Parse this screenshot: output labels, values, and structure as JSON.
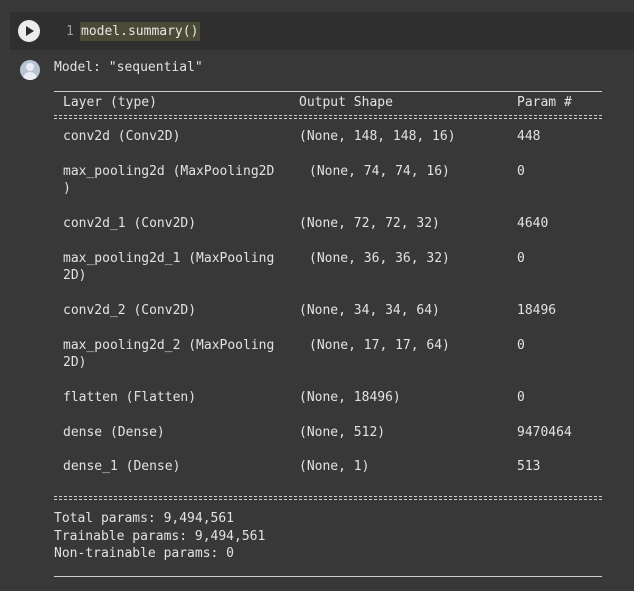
{
  "cell": {
    "line_number": "1",
    "code": "model.summary()"
  },
  "output": {
    "model_title": "Model: \"sequential\"",
    "headers": {
      "layer": "Layer (type)",
      "shape": "Output Shape",
      "params": "Param #"
    },
    "rows": [
      {
        "layer": "conv2d (Conv2D)",
        "layer_cont": "",
        "shape": "(None, 148, 148, 16)",
        "params": "448"
      },
      {
        "layer": "max_pooling2d (MaxPooling2D",
        "layer_cont": ")",
        "shape": "(None, 74, 74, 16)",
        "params": "0"
      },
      {
        "layer": "conv2d_1 (Conv2D)",
        "layer_cont": "",
        "shape": "(None, 72, 72, 32)",
        "params": "4640"
      },
      {
        "layer": "max_pooling2d_1 (MaxPooling",
        "layer_cont": "2D)",
        "shape": "(None, 36, 36, 32)",
        "params": "0"
      },
      {
        "layer": "conv2d_2 (Conv2D)",
        "layer_cont": "",
        "shape": "(None, 34, 34, 64)",
        "params": "18496"
      },
      {
        "layer": "max_pooling2d_2 (MaxPooling",
        "layer_cont": "2D)",
        "shape": "(None, 17, 17, 64)",
        "params": "0"
      },
      {
        "layer": "flatten (Flatten)",
        "layer_cont": "",
        "shape": "(None, 18496)",
        "params": "0"
      },
      {
        "layer": "dense (Dense)",
        "layer_cont": "",
        "shape": "(None, 512)",
        "params": "9470464"
      },
      {
        "layer": "dense_1 (Dense)",
        "layer_cont": "",
        "shape": "(None, 1)",
        "params": "513"
      }
    ],
    "total_params": "Total params: 9,494,561",
    "trainable_params": "Trainable params: 9,494,561",
    "non_trainable_params": "Non-trainable params: 0"
  }
}
